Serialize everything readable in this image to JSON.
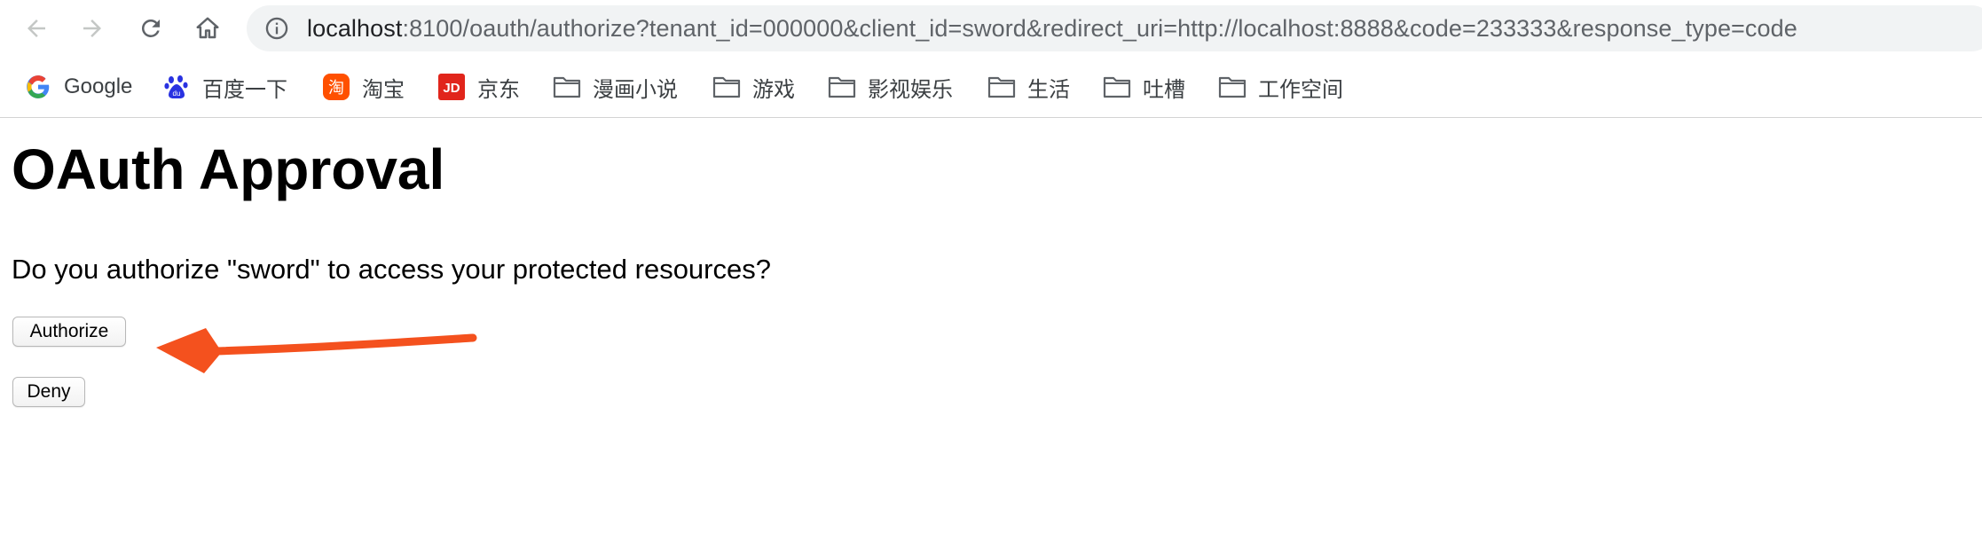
{
  "browser": {
    "address_bar": {
      "host": "localhost",
      "rest": ":8100/oauth/authorize?tenant_id=000000&client_id=sword&redirect_uri=http://localhost:8888&code=233333&response_type=code"
    },
    "nav_icons": [
      "back-icon",
      "forward-icon",
      "reload-icon",
      "home-icon"
    ],
    "bookmarks": [
      {
        "label": "Google",
        "icon": "google-icon"
      },
      {
        "label": "百度一下",
        "icon": "baidu-icon"
      },
      {
        "label": "淘宝",
        "icon": "taobao-icon"
      },
      {
        "label": "京东",
        "icon": "jd-icon"
      },
      {
        "label": "漫画小说",
        "icon": "folder-icon"
      },
      {
        "label": "游戏",
        "icon": "folder-icon"
      },
      {
        "label": "影视娱乐",
        "icon": "folder-icon"
      },
      {
        "label": "生活",
        "icon": "folder-icon"
      },
      {
        "label": "吐槽",
        "icon": "folder-icon"
      },
      {
        "label": "工作空间",
        "icon": "folder-icon"
      }
    ]
  },
  "page": {
    "title": "OAuth Approval",
    "question": "Do you authorize \"sword\" to access your protected resources?",
    "authorize_label": "Authorize",
    "deny_label": "Deny"
  },
  "annotation": {
    "arrow_color": "#f4511e",
    "icon": "red-arrow-icon"
  }
}
